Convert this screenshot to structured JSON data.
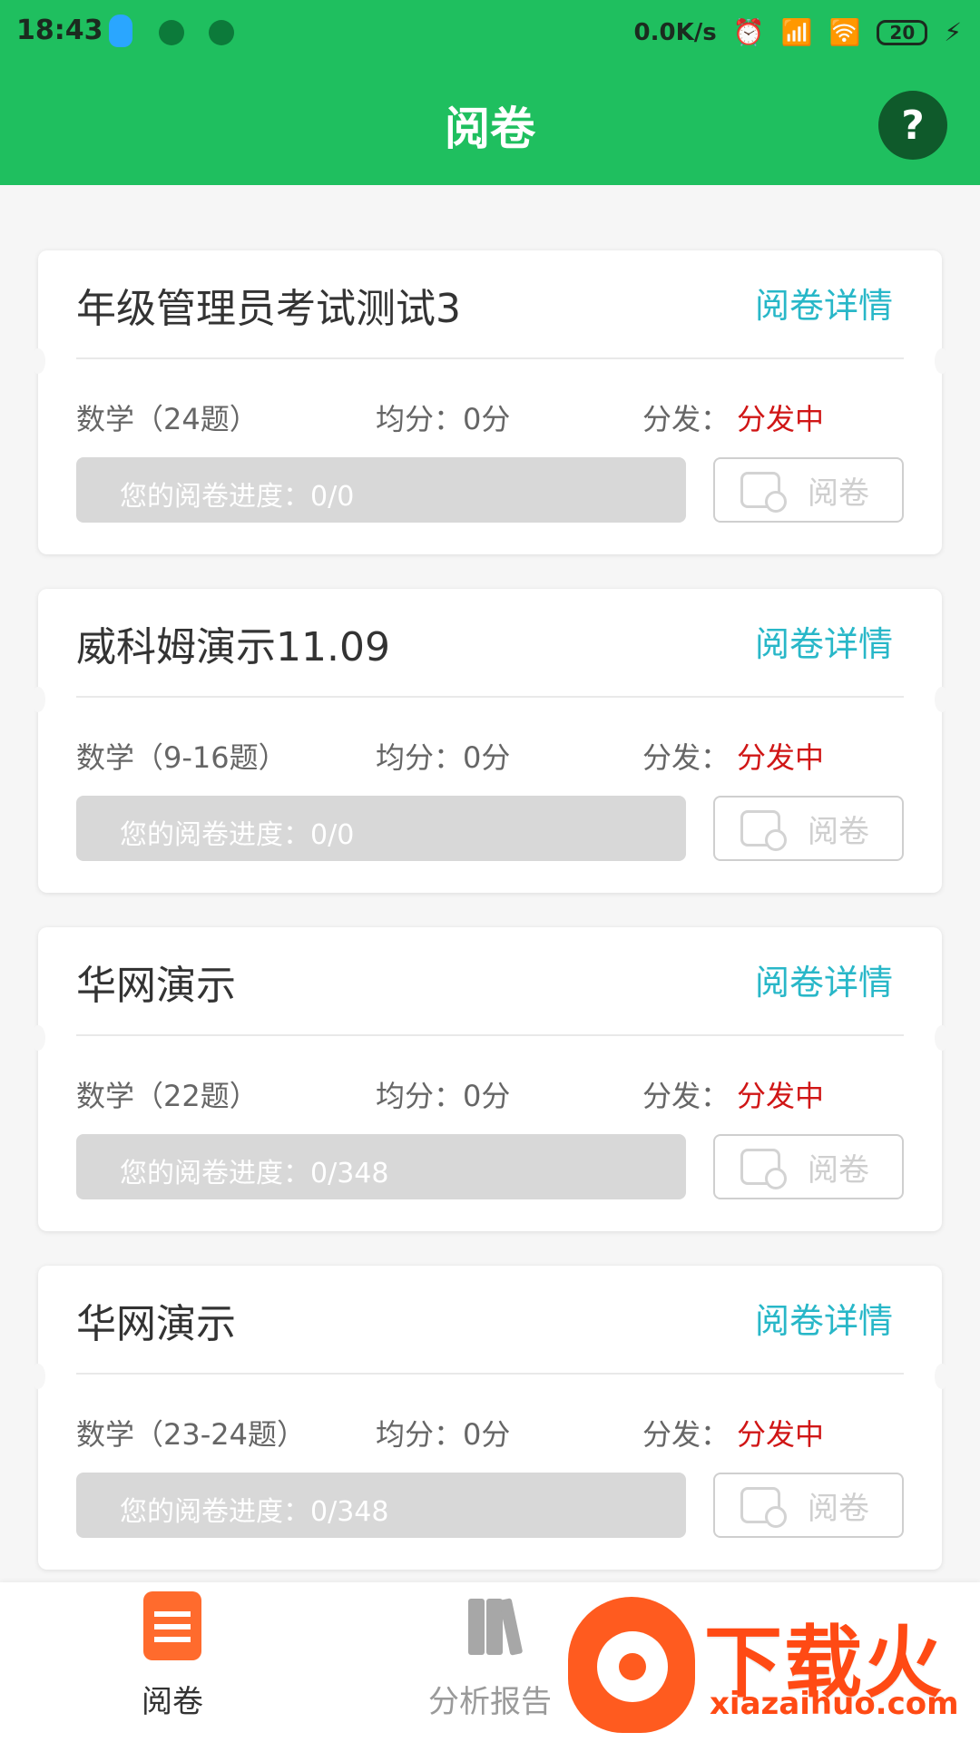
{
  "status_bar": {
    "time": "18:43",
    "network_speed": "0.0K/s",
    "battery": "20"
  },
  "app_bar": {
    "title": "阅卷",
    "help_label": "?"
  },
  "cards": [
    {
      "title": "年级管理员考试测试3",
      "detail_label": "阅卷详情",
      "subject": "数学（24题）",
      "average": "均分：0分",
      "distribution_label": "分发：",
      "distribution_status": "分发中",
      "progress_text": "您的阅卷进度：0/0",
      "progress_ratio": 0,
      "grade_button": "阅卷"
    },
    {
      "title": "威科姆演示11.09",
      "detail_label": "阅卷详情",
      "subject": "数学（9-16题）",
      "average": "均分：0分",
      "distribution_label": "分发：",
      "distribution_status": "分发中",
      "progress_text": "您的阅卷进度：0/0",
      "progress_ratio": 0,
      "grade_button": "阅卷"
    },
    {
      "title": "华网演示",
      "detail_label": "阅卷详情",
      "subject": "数学（22题）",
      "average": "均分：0分",
      "distribution_label": "分发：",
      "distribution_status": "分发中",
      "progress_text": "您的阅卷进度：0/348",
      "progress_ratio": 0,
      "grade_button": "阅卷"
    },
    {
      "title": "华网演示",
      "detail_label": "阅卷详情",
      "subject": "数学（23-24题）",
      "average": "均分：0分",
      "distribution_label": "分发：",
      "distribution_status": "分发中",
      "progress_text": "您的阅卷进度：0/348",
      "progress_ratio": 0,
      "grade_button": "阅卷"
    }
  ],
  "bottom_nav": {
    "items": [
      {
        "label": "阅卷",
        "icon": "exam-paper-icon",
        "active": true
      },
      {
        "label": "分析报告",
        "icon": "report-books-icon",
        "active": false
      }
    ]
  },
  "watermark": {
    "main": "下载火",
    "sub": "xiazaihuo.com"
  },
  "colors": {
    "primary_green": "#1fbf5f",
    "link_teal": "#28b7c8",
    "status_red": "#d01616",
    "watermark_orange": "#ff4a14"
  }
}
